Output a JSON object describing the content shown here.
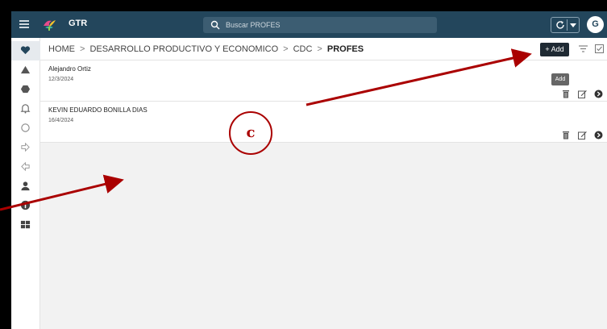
{
  "app": {
    "title": "GTR"
  },
  "search": {
    "placeholder": "Buscar PROFES"
  },
  "user": {
    "avatar_initial": "G"
  },
  "breadcrumb": {
    "items": [
      "HOME",
      "DESARROLLO PRODUCTIVO Y ECONOMICO",
      "CDC",
      "PROFES"
    ],
    "separator": ">"
  },
  "toolbar": {
    "add_label": "+ Add",
    "add_tooltip": "Add"
  },
  "records": [
    {
      "name": "Alejandro Ortiz",
      "date": "12/3/2024"
    },
    {
      "name": "KEVIN EDUARDO BONILLA DIAS",
      "date": "16/4/2024"
    }
  ],
  "sidebar": {
    "icons": [
      "heart-icon",
      "triangle-icon",
      "hexagon-icon",
      "bell-icon",
      "circle-icon",
      "arrow-right-icon",
      "arrow-left-icon",
      "person-icon",
      "info-icon",
      "grid-icon"
    ]
  },
  "annotation": {
    "label": "c",
    "color": "#a00000"
  },
  "colors": {
    "topbar": "#23465c",
    "add_button": "#1f2a33",
    "accent_red": "#a00000"
  }
}
